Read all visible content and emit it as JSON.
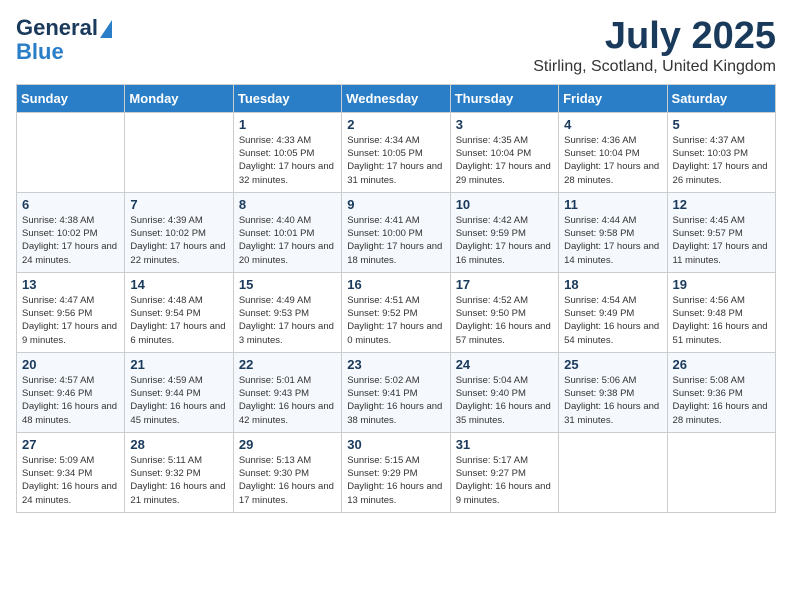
{
  "header": {
    "logo_line1": "General",
    "logo_line2": "Blue",
    "month_year": "July 2025",
    "location": "Stirling, Scotland, United Kingdom"
  },
  "days_of_week": [
    "Sunday",
    "Monday",
    "Tuesday",
    "Wednesday",
    "Thursday",
    "Friday",
    "Saturday"
  ],
  "weeks": [
    [
      {
        "day": "",
        "info": ""
      },
      {
        "day": "",
        "info": ""
      },
      {
        "day": "1",
        "info": "Sunrise: 4:33 AM\nSunset: 10:05 PM\nDaylight: 17 hours and 32 minutes."
      },
      {
        "day": "2",
        "info": "Sunrise: 4:34 AM\nSunset: 10:05 PM\nDaylight: 17 hours and 31 minutes."
      },
      {
        "day": "3",
        "info": "Sunrise: 4:35 AM\nSunset: 10:04 PM\nDaylight: 17 hours and 29 minutes."
      },
      {
        "day": "4",
        "info": "Sunrise: 4:36 AM\nSunset: 10:04 PM\nDaylight: 17 hours and 28 minutes."
      },
      {
        "day": "5",
        "info": "Sunrise: 4:37 AM\nSunset: 10:03 PM\nDaylight: 17 hours and 26 minutes."
      }
    ],
    [
      {
        "day": "6",
        "info": "Sunrise: 4:38 AM\nSunset: 10:02 PM\nDaylight: 17 hours and 24 minutes."
      },
      {
        "day": "7",
        "info": "Sunrise: 4:39 AM\nSunset: 10:02 PM\nDaylight: 17 hours and 22 minutes."
      },
      {
        "day": "8",
        "info": "Sunrise: 4:40 AM\nSunset: 10:01 PM\nDaylight: 17 hours and 20 minutes."
      },
      {
        "day": "9",
        "info": "Sunrise: 4:41 AM\nSunset: 10:00 PM\nDaylight: 17 hours and 18 minutes."
      },
      {
        "day": "10",
        "info": "Sunrise: 4:42 AM\nSunset: 9:59 PM\nDaylight: 17 hours and 16 minutes."
      },
      {
        "day": "11",
        "info": "Sunrise: 4:44 AM\nSunset: 9:58 PM\nDaylight: 17 hours and 14 minutes."
      },
      {
        "day": "12",
        "info": "Sunrise: 4:45 AM\nSunset: 9:57 PM\nDaylight: 17 hours and 11 minutes."
      }
    ],
    [
      {
        "day": "13",
        "info": "Sunrise: 4:47 AM\nSunset: 9:56 PM\nDaylight: 17 hours and 9 minutes."
      },
      {
        "day": "14",
        "info": "Sunrise: 4:48 AM\nSunset: 9:54 PM\nDaylight: 17 hours and 6 minutes."
      },
      {
        "day": "15",
        "info": "Sunrise: 4:49 AM\nSunset: 9:53 PM\nDaylight: 17 hours and 3 minutes."
      },
      {
        "day": "16",
        "info": "Sunrise: 4:51 AM\nSunset: 9:52 PM\nDaylight: 17 hours and 0 minutes."
      },
      {
        "day": "17",
        "info": "Sunrise: 4:52 AM\nSunset: 9:50 PM\nDaylight: 16 hours and 57 minutes."
      },
      {
        "day": "18",
        "info": "Sunrise: 4:54 AM\nSunset: 9:49 PM\nDaylight: 16 hours and 54 minutes."
      },
      {
        "day": "19",
        "info": "Sunrise: 4:56 AM\nSunset: 9:48 PM\nDaylight: 16 hours and 51 minutes."
      }
    ],
    [
      {
        "day": "20",
        "info": "Sunrise: 4:57 AM\nSunset: 9:46 PM\nDaylight: 16 hours and 48 minutes."
      },
      {
        "day": "21",
        "info": "Sunrise: 4:59 AM\nSunset: 9:44 PM\nDaylight: 16 hours and 45 minutes."
      },
      {
        "day": "22",
        "info": "Sunrise: 5:01 AM\nSunset: 9:43 PM\nDaylight: 16 hours and 42 minutes."
      },
      {
        "day": "23",
        "info": "Sunrise: 5:02 AM\nSunset: 9:41 PM\nDaylight: 16 hours and 38 minutes."
      },
      {
        "day": "24",
        "info": "Sunrise: 5:04 AM\nSunset: 9:40 PM\nDaylight: 16 hours and 35 minutes."
      },
      {
        "day": "25",
        "info": "Sunrise: 5:06 AM\nSunset: 9:38 PM\nDaylight: 16 hours and 31 minutes."
      },
      {
        "day": "26",
        "info": "Sunrise: 5:08 AM\nSunset: 9:36 PM\nDaylight: 16 hours and 28 minutes."
      }
    ],
    [
      {
        "day": "27",
        "info": "Sunrise: 5:09 AM\nSunset: 9:34 PM\nDaylight: 16 hours and 24 minutes."
      },
      {
        "day": "28",
        "info": "Sunrise: 5:11 AM\nSunset: 9:32 PM\nDaylight: 16 hours and 21 minutes."
      },
      {
        "day": "29",
        "info": "Sunrise: 5:13 AM\nSunset: 9:30 PM\nDaylight: 16 hours and 17 minutes."
      },
      {
        "day": "30",
        "info": "Sunrise: 5:15 AM\nSunset: 9:29 PM\nDaylight: 16 hours and 13 minutes."
      },
      {
        "day": "31",
        "info": "Sunrise: 5:17 AM\nSunset: 9:27 PM\nDaylight: 16 hours and 9 minutes."
      },
      {
        "day": "",
        "info": ""
      },
      {
        "day": "",
        "info": ""
      }
    ]
  ]
}
